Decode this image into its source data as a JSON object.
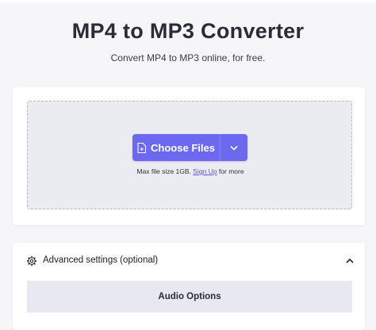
{
  "header": {
    "title": "MP4 to MP3 Converter",
    "subtitle": "Convert MP4 to MP3 online, for free."
  },
  "upload": {
    "choose_label": "Choose Files",
    "limit_prefix": "Max file size 1GB.",
    "signup_label": "Sign Up",
    "limit_suffix": "for more"
  },
  "settings": {
    "label": "Advanced settings (optional)",
    "section_title": "Audio Options"
  },
  "icons": {
    "file": "file-plus-icon",
    "dropdown": "chevron-down-icon",
    "settings": "gear-icon",
    "collapse": "chevron-up-icon"
  },
  "colors": {
    "accent": "#6c68ef",
    "link": "#5a57e8"
  }
}
